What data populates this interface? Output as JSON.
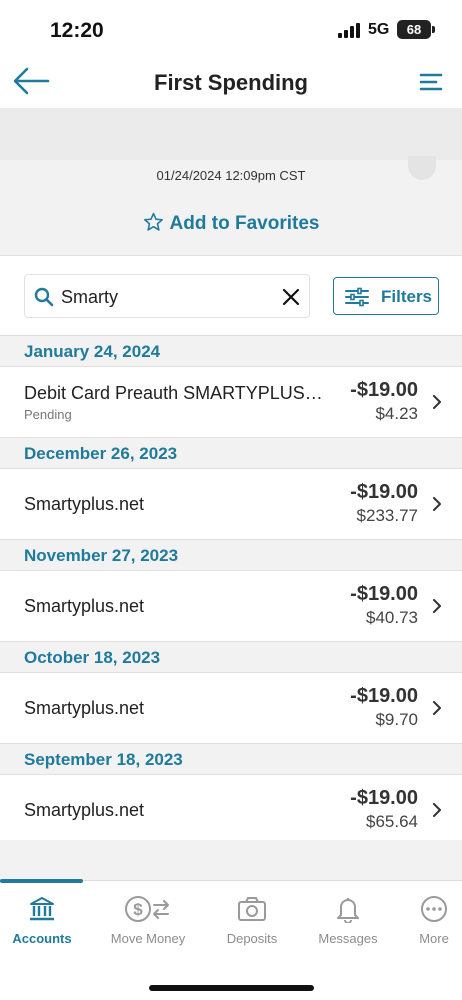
{
  "status_bar": {
    "time": "12:20",
    "network": "5G",
    "battery": "68"
  },
  "header": {
    "title": "First Spending",
    "back_icon": "back-arrow-icon",
    "menu_icon": "hamburger-menu-icon"
  },
  "account_panel": {
    "timestamp": "01/24/2024 12:09pm CST",
    "favorite_label": "Add to Favorites"
  },
  "search": {
    "value": "Smarty",
    "placeholder": "Search",
    "filters_label": "Filters"
  },
  "transactions": [
    {
      "date": "January 24, 2024",
      "name": "Debit Card Preauth SMARTYPLUS…",
      "status": "Pending",
      "amount": "-$19.00",
      "balance": "$4.23"
    },
    {
      "date": "December 26, 2023",
      "name": "Smartyplus.net",
      "status": "",
      "amount": "-$19.00",
      "balance": "$233.77"
    },
    {
      "date": "November 27, 2023",
      "name": "Smartyplus.net",
      "status": "",
      "amount": "-$19.00",
      "balance": "$40.73"
    },
    {
      "date": "October 18, 2023",
      "name": "Smartyplus.net",
      "status": "",
      "amount": "-$19.00",
      "balance": "$9.70"
    },
    {
      "date": "September 18, 2023",
      "name": "Smartyplus.net",
      "status": "",
      "amount": "-$19.00",
      "balance": "$65.64"
    }
  ],
  "tabbar": {
    "tabs": [
      {
        "label": "Accounts",
        "icon": "bank-icon",
        "active": true
      },
      {
        "label": "Move Money",
        "icon": "transfer-money-icon",
        "active": false
      },
      {
        "label": "Deposits",
        "icon": "camera-icon",
        "active": false
      },
      {
        "label": "Messages",
        "icon": "bell-icon",
        "active": false
      },
      {
        "label": "More",
        "icon": "more-dots-icon",
        "active": false
      }
    ]
  },
  "colors": {
    "accent": "#1f7a9c",
    "text": "#222222",
    "muted": "#8c8c8c",
    "panel": "#f2f2f2"
  }
}
